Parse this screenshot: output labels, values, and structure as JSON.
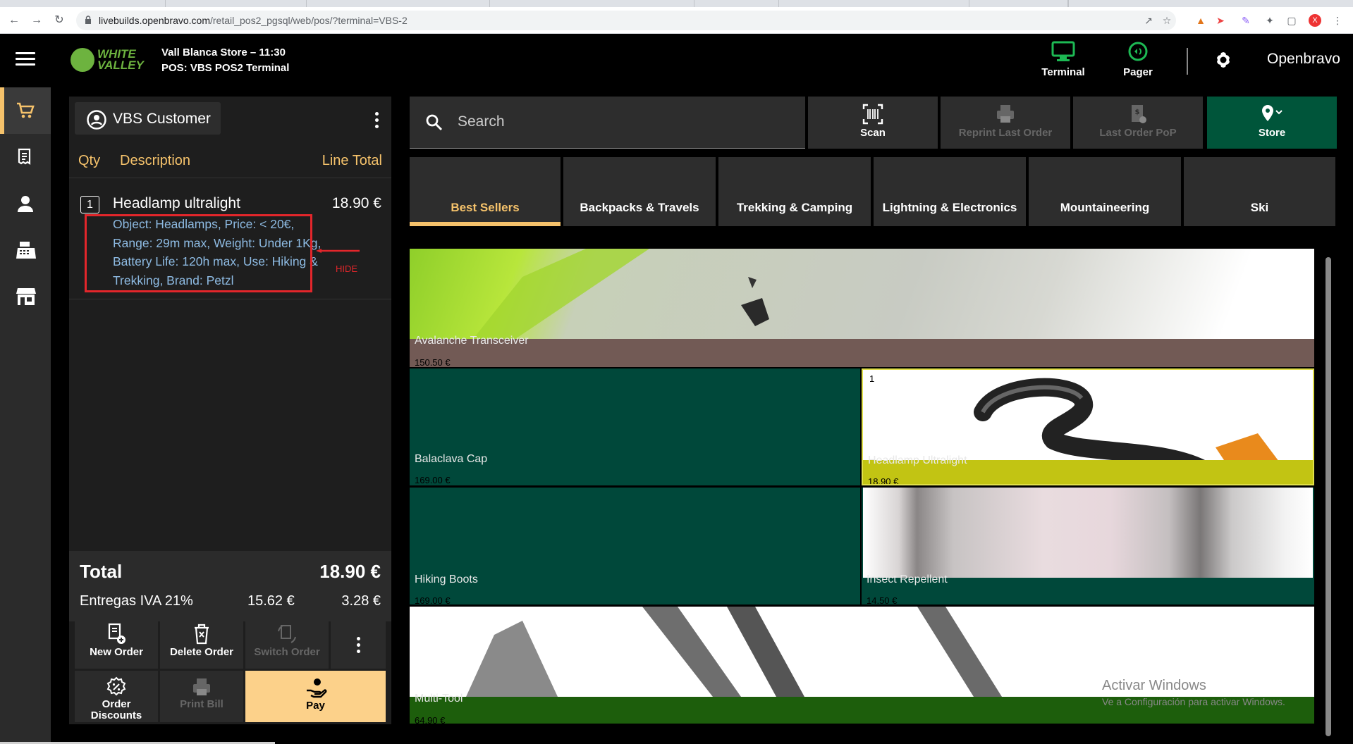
{
  "browser": {
    "url_host": "livebuilds.openbravo.com",
    "url_path": "/retail_pos2_pgsql/web/pos/?terminal=VBS-2"
  },
  "header": {
    "logo_line1": "WHITE",
    "logo_line2": "VALLEY",
    "store_line": "Vall Blanca Store – 11:30",
    "pos_line": "POS: VBS POS2 Terminal",
    "terminal_label": "Terminal",
    "pager_label": "Pager",
    "brand": "Openbravo"
  },
  "ticket": {
    "customer": "VBS Customer",
    "col_qty": "Qty",
    "col_desc": "Description",
    "col_total": "Line Total",
    "line": {
      "qty": "1",
      "name": "Headlamp ultralight",
      "price": "18.90 €",
      "description": "Object: Headlamps, Price: < 20€, Range: 29m max, Weight: Under 1Kg, Battery Life: 120h max, Use: Hiking & Trekking, Brand: Petzl"
    },
    "annotation": "HIDE",
    "total_label": "Total",
    "total_value": "18.90 €",
    "tax_label": "Entregas IVA 21%",
    "tax_base": "15.62 €",
    "tax_value": "3.28 €"
  },
  "actions": {
    "new_order": "New Order",
    "delete_order": "Delete Order",
    "switch_order": "Switch Order",
    "order_discounts": "Order Discounts",
    "print_bill": "Print Bill",
    "pay": "Pay"
  },
  "toolbar": {
    "search_placeholder": "Search",
    "scan": "Scan",
    "reprint": "Reprint Last Order",
    "last_pop": "Last Order PoP",
    "store": "Store"
  },
  "categories": [
    "Best Sellers",
    "Backpacks & Travels",
    "Trekking & Camping",
    "Lightning & Electronics",
    "Mountaineering",
    "Ski"
  ],
  "products": [
    {
      "name": "Avalanche Transceiver",
      "price": "150.50 €"
    },
    {
      "name": "Balaclava Cap",
      "price": "169.00 €"
    },
    {
      "name": "Headlamp Ultralight",
      "price": "18.90 €",
      "stock": "1"
    },
    {
      "name": "Hiking Boots",
      "price": "169.00 €"
    },
    {
      "name": "Insect Repellent",
      "price": "14.50 €"
    },
    {
      "name": "Multi-Tool",
      "price": "64.90 €"
    }
  ],
  "windows": {
    "line1": "Activar Windows",
    "line2": "Ve a Configuración para activar Windows."
  },
  "colors": {
    "accent": "#f5c26b",
    "store_green": "#00553a",
    "pay_bg": "#fcd18a",
    "annotation_red": "#e3262b"
  }
}
